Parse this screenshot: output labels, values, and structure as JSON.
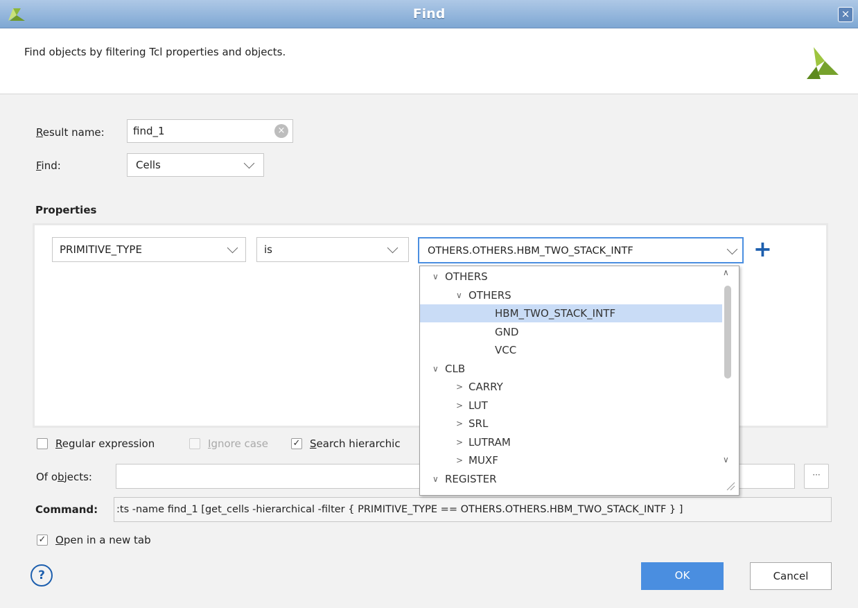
{
  "window": {
    "title": "Find",
    "close_glyph": "×"
  },
  "header": {
    "description": "Find objects by filtering Tcl properties and objects."
  },
  "form": {
    "result_name_label_underline": "R",
    "result_name_label_rest": "esult name:",
    "result_name_value": "find_1",
    "find_label_underline": "F",
    "find_label_rest": "ind:",
    "find_value": "Cells"
  },
  "properties": {
    "heading": "Properties",
    "property_value": "PRIMITIVE_TYPE",
    "operator_value": "is",
    "value_value": "OTHERS.OTHERS.HBM_TWO_STACK_INTF",
    "add_glyph": "+"
  },
  "dropdown": {
    "items": [
      {
        "label": "OTHERS",
        "arrow": "∨",
        "level": 0,
        "selected": false
      },
      {
        "label": "OTHERS",
        "arrow": "∨",
        "level": 1,
        "selected": false
      },
      {
        "label": "HBM_TWO_STACK_INTF",
        "arrow": "",
        "level": 2,
        "selected": true
      },
      {
        "label": "GND",
        "arrow": "",
        "level": 2,
        "selected": false
      },
      {
        "label": "VCC",
        "arrow": "",
        "level": 2,
        "selected": false
      },
      {
        "label": "CLB",
        "arrow": "∨",
        "level": 0,
        "selected": false
      },
      {
        "label": "CARRY",
        "arrow": ">",
        "level": 1,
        "selected": false
      },
      {
        "label": "LUT",
        "arrow": ">",
        "level": 1,
        "selected": false
      },
      {
        "label": "SRL",
        "arrow": ">",
        "level": 1,
        "selected": false
      },
      {
        "label": "LUTRAM",
        "arrow": ">",
        "level": 1,
        "selected": false
      },
      {
        "label": "MUXF",
        "arrow": ">",
        "level": 1,
        "selected": false
      },
      {
        "label": "REGISTER",
        "arrow": "∨",
        "level": 0,
        "selected": false
      }
    ]
  },
  "options": {
    "regex_underline": "R",
    "regex_rest": "egular expression",
    "regex_checked": false,
    "ignore_case_underline": "I",
    "ignore_case_rest": "gnore case",
    "ignore_case_checked": false,
    "search_hier_underline": "S",
    "search_hier_rest": "earch hierarchic",
    "search_hier_checked": true,
    "check_glyph": "✓"
  },
  "of_objects": {
    "label_pre": "Of o",
    "label_underline": "b",
    "label_post": "jects:",
    "value": "",
    "browse_glyph": "···"
  },
  "command": {
    "label": "Command:",
    "value": ":ts -name find_1 [get_cells -hierarchical -filter { PRIMITIVE_TYPE == OTHERS.OTHERS.HBM_TWO_STACK_INTF } ]"
  },
  "open_new_tab": {
    "underline": "O",
    "rest": "pen in a new tab",
    "checked": true
  },
  "footer": {
    "help_glyph": "?",
    "ok_label": "OK",
    "cancel_label": "Cancel"
  },
  "colors": {
    "accent": "#4a8ee0",
    "selection": "#c9dcf6",
    "logo": "#8cb63c"
  }
}
